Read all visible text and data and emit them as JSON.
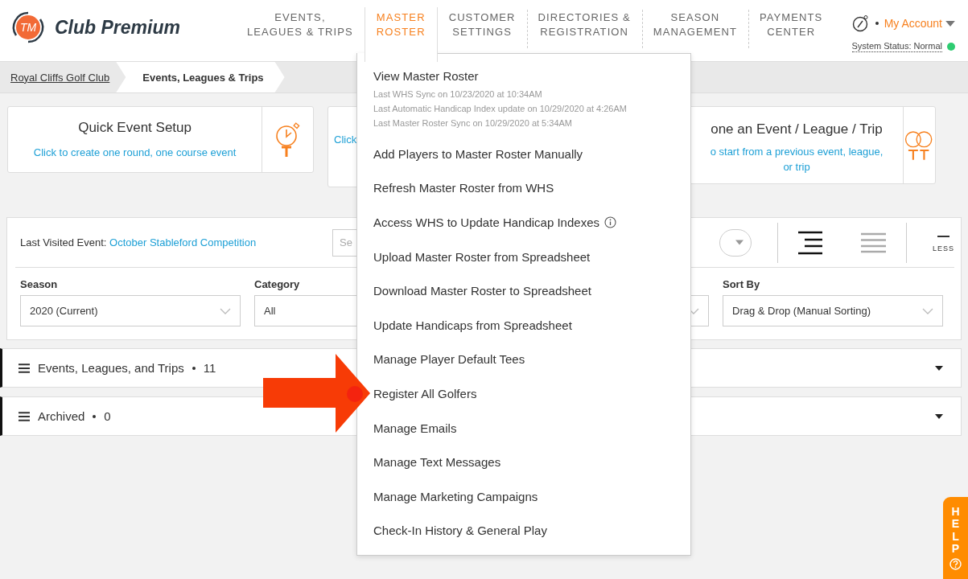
{
  "header": {
    "logo": {
      "mark": "TM",
      "name": "Club Premium"
    },
    "nav": [
      {
        "label": "EVENTS,\nLEAGUES & TRIPS",
        "selected": false
      },
      {
        "label": "MASTER\nROSTER",
        "selected": true
      },
      {
        "label": "CUSTOMER\nSETTINGS",
        "selected": false
      },
      {
        "label": "DIRECTORIES &\nREGISTRATION",
        "selected": false
      },
      {
        "label": "SEASON\nMANAGEMENT",
        "selected": false
      },
      {
        "label": "PAYMENTS\nCENTER",
        "selected": false
      }
    ],
    "account": {
      "label": "My Account"
    },
    "status": {
      "text": "System Status: Normal",
      "color": "#2ecc71"
    }
  },
  "breadcrumbs": [
    {
      "label": "Royal Cliffs Golf Club",
      "current": false
    },
    {
      "label": "Events, Leagues & Trips",
      "current": true
    }
  ],
  "cards": [
    {
      "kind": "quick",
      "title": "Quick Event Setup",
      "subtitle": "Click to create one round, one course event"
    },
    {
      "kind": "covered",
      "subtitle": "Click"
    },
    {
      "kind": "clone",
      "title": "one an Event / League / Trip",
      "subtitle": "o start from a previous event, league, or trip"
    }
  ],
  "filters": {
    "last_visited": {
      "label": "Last Visited Event:",
      "link": "October Stableford Competition"
    },
    "search": {
      "placeholder": "Se"
    },
    "views": [
      {
        "kind": "align",
        "selected": true
      },
      {
        "kind": "list",
        "selected": false
      }
    ],
    "less": "LESS",
    "fields": [
      {
        "kind": "select",
        "label": "Season",
        "value": "2020 (Current)"
      },
      {
        "kind": "partial",
        "label": "Category",
        "value": "All"
      },
      {
        "kind": "covered"
      },
      {
        "kind": "select",
        "label": "Sort By",
        "value": "Drag & Drop (Manual Sorting)"
      }
    ]
  },
  "sections": [
    {
      "title": "Events, Leagues, and Trips",
      "count": "11"
    },
    {
      "title": "Archived",
      "count": "0"
    }
  ],
  "menu": {
    "items": [
      {
        "kind": "heading",
        "label": "View Master Roster",
        "notes": [
          "Last WHS Sync on 10/23/2020 at 10:34AM",
          "Last Automatic Handicap Index update on 10/29/2020 at 4:26AM",
          "Last Master Roster Sync on 10/29/2020 at 5:34AM"
        ]
      },
      {
        "kind": "plain",
        "label": "Add Players to Master Roster Manually"
      },
      {
        "kind": "plain",
        "label": "Refresh Master Roster from WHS"
      },
      {
        "kind": "info",
        "label": "Access WHS to Update Handicap Indexes"
      },
      {
        "kind": "plain",
        "label": "Upload Master Roster from Spreadsheet"
      },
      {
        "kind": "plain",
        "label": "Download Master Roster to Spreadsheet"
      },
      {
        "kind": "plain",
        "label": "Update Handicaps from Spreadsheet"
      },
      {
        "kind": "plain",
        "label": "Manage Player Default Tees"
      },
      {
        "kind": "plain",
        "label": "Register All Golfers"
      },
      {
        "kind": "plain",
        "label": "Manage Emails"
      },
      {
        "kind": "plain",
        "label": "Manage Text Messages"
      },
      {
        "kind": "plain",
        "label": "Manage Marketing Campaigns"
      },
      {
        "kind": "plain",
        "label": "Check-In History & General Play"
      }
    ]
  },
  "help": {
    "label": "HELP"
  }
}
